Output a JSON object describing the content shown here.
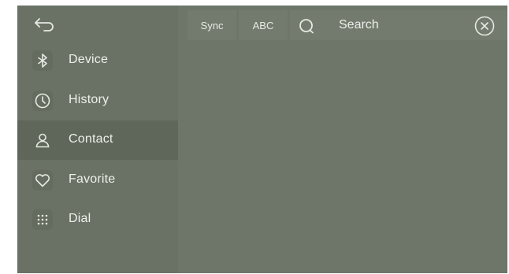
{
  "colors": {
    "screen_bg": "#6e7669",
    "sidebar_bg": "#6a7265",
    "active_item_bg": "#5f675a",
    "text": "#eef0ea",
    "icon_stroke": "#e6e9e2"
  },
  "header": {
    "back_icon": "back-arrow-icon"
  },
  "sidebar": {
    "items": [
      {
        "label": "Device",
        "icon": "bluetooth-icon",
        "active": false
      },
      {
        "label": "History",
        "icon": "clock-icon",
        "active": false
      },
      {
        "label": "Contact",
        "icon": "person-icon",
        "active": true
      },
      {
        "label": "Favorite",
        "icon": "heart-icon",
        "active": false
      },
      {
        "label": "Dial",
        "icon": "dialpad-icon",
        "active": false
      }
    ]
  },
  "toolbar": {
    "sync_label": "Sync",
    "abc_label": "ABC",
    "search_placeholder": "Search",
    "search_value": "",
    "search_icon": "search-icon",
    "clear_icon": "clear-circle-x-icon"
  }
}
